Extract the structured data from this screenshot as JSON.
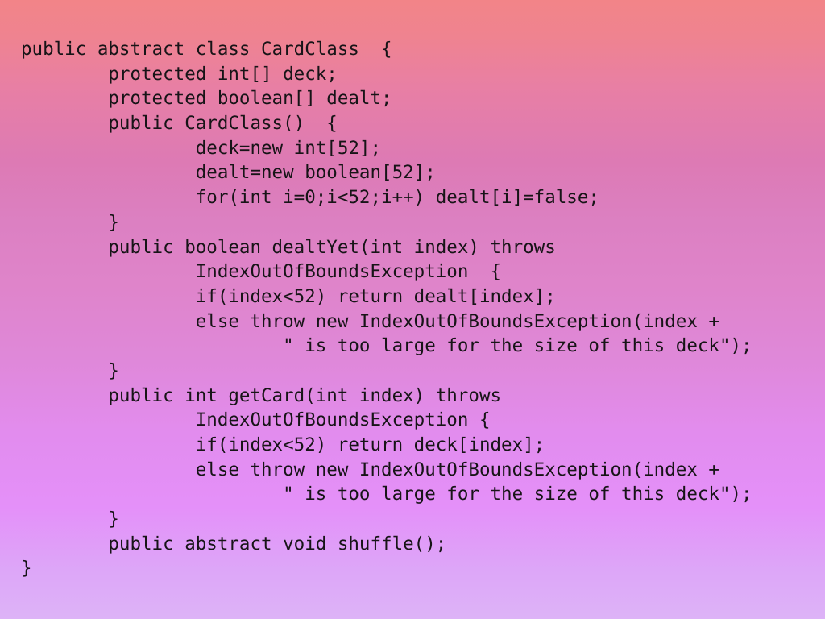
{
  "slide": {
    "kind": "code-slide",
    "language": "java",
    "class_name": "CardClass",
    "text_color": "#171417",
    "background": {
      "type": "vertical-gradient",
      "stops": [
        "#f28488",
        "#e87fa4",
        "#dd7ab4",
        "#df84ca",
        "#e28cee",
        "#e490f9",
        "#ddb3f7"
      ]
    },
    "code_lines": [
      "public abstract class CardClass  {",
      "        protected int[] deck;",
      "        protected boolean[] dealt;",
      "        public CardClass()  {",
      "                deck=new int[52];",
      "                dealt=new boolean[52];",
      "                for(int i=0;i<52;i++) dealt[i]=false;",
      "        }",
      "        public boolean dealtYet(int index) throws",
      "                IndexOutOfBoundsException  {",
      "                if(index<52) return dealt[index];",
      "                else throw new IndexOutOfBoundsException(index +",
      "                        \" is too large for the size of this deck\");",
      "        }",
      "        public int getCard(int index) throws",
      "                IndexOutOfBoundsException {",
      "                if(index<52) return deck[index];",
      "                else throw new IndexOutOfBoundsException(index +",
      "                        \" is too large for the size of this deck\");",
      "        }",
      "        public abstract void shuffle();",
      "}"
    ]
  }
}
